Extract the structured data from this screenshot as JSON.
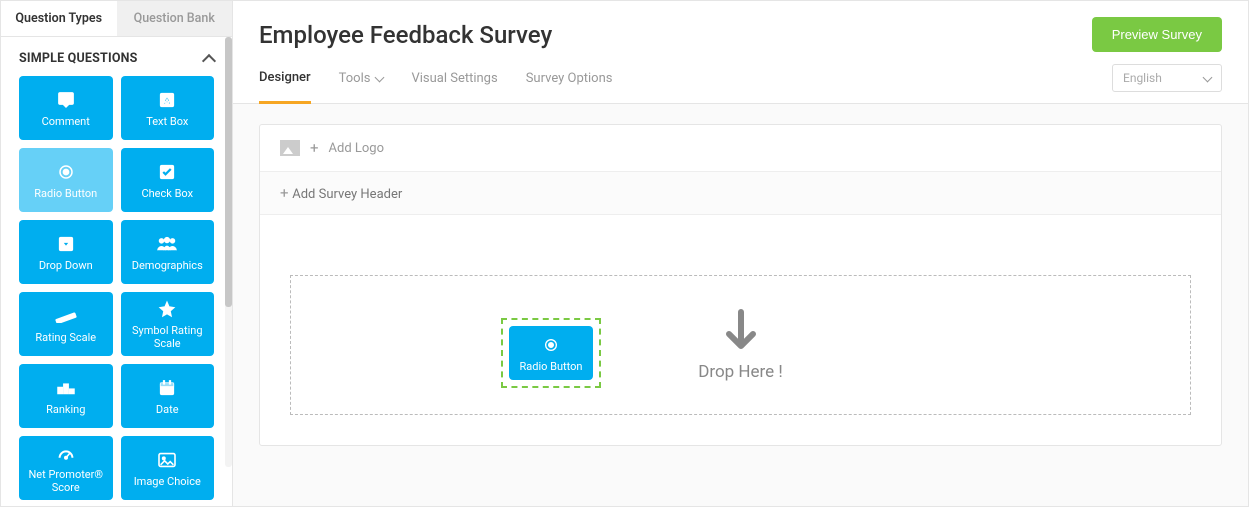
{
  "sidebar": {
    "tabs": [
      {
        "label": "Question Types",
        "active": true
      },
      {
        "label": "Question Bank",
        "active": false
      }
    ],
    "section_title": "SIMPLE QUESTIONS",
    "items": [
      {
        "label": "Comment",
        "icon": "comment"
      },
      {
        "label": "Text Box",
        "icon": "textbox"
      },
      {
        "label": "Radio Button",
        "icon": "radio",
        "selected": true
      },
      {
        "label": "Check Box",
        "icon": "checkbox"
      },
      {
        "label": "Drop Down",
        "icon": "dropdown"
      },
      {
        "label": "Demographics",
        "icon": "demographics"
      },
      {
        "label": "Rating Scale",
        "icon": "ruler"
      },
      {
        "label": "Symbol Rating Scale",
        "icon": "star"
      },
      {
        "label": "Ranking",
        "icon": "ranking"
      },
      {
        "label": "Date",
        "icon": "date"
      },
      {
        "label": "Net Promoter® Score",
        "icon": "gauge"
      },
      {
        "label": "Image Choice",
        "icon": "image"
      }
    ]
  },
  "header": {
    "title": "Employee Feedback Survey",
    "preview_label": "Preview Survey",
    "tabs": [
      {
        "label": "Designer",
        "active": true
      },
      {
        "label": "Tools",
        "dropdown": true
      },
      {
        "label": "Visual Settings"
      },
      {
        "label": "Survey Options"
      }
    ],
    "language": "English"
  },
  "canvas": {
    "add_logo": "Add Logo",
    "add_header": "Add Survey Header",
    "drop_text": "Drop Here !",
    "drag_ghost_label": "Radio Button"
  }
}
